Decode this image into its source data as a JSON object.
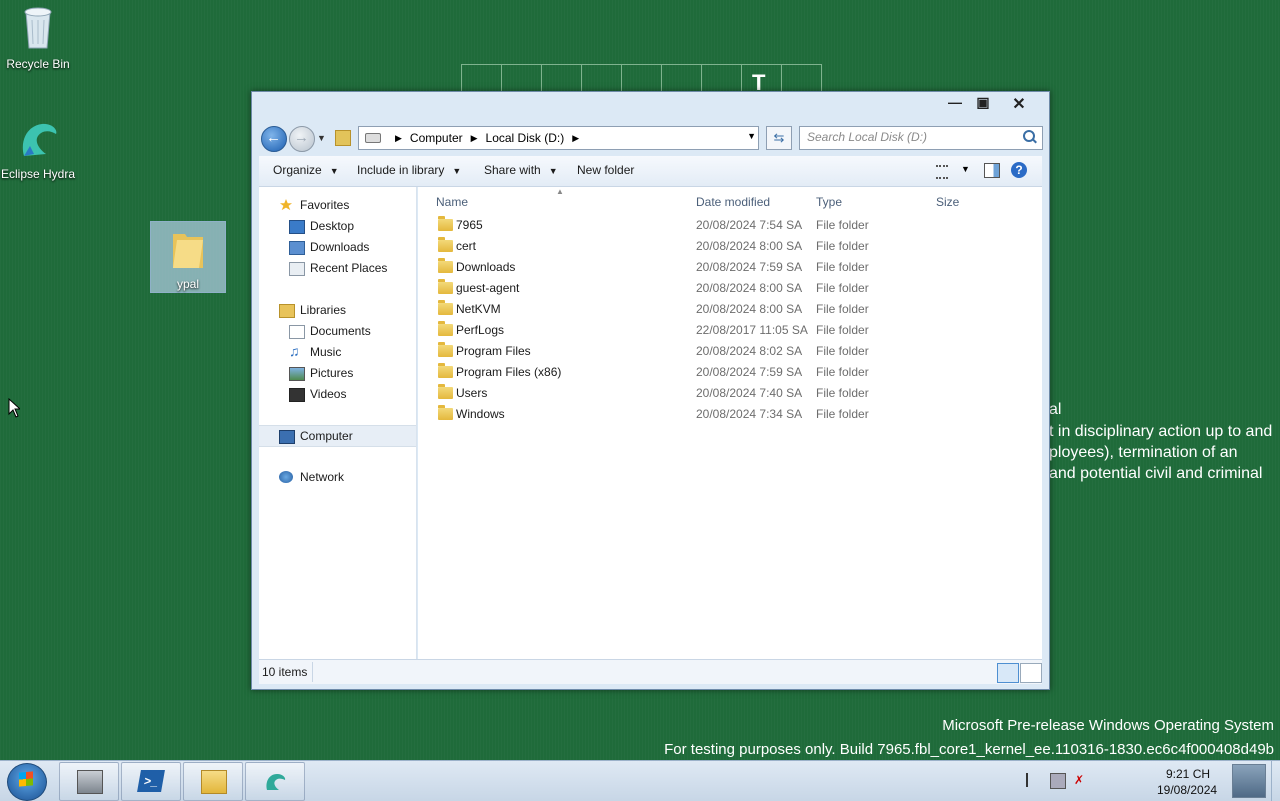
{
  "desktop": {
    "icons": [
      {
        "label": "Recycle Bin"
      },
      {
        "label": "Eclipse Hydra"
      },
      {
        "label": "ypal"
      }
    ],
    "bg_letter": "T",
    "notice_lines": [
      "al",
      "t in disciplinary action up to and",
      "ployees), termination of an",
      "and potential civil and criminal"
    ],
    "build_lines": [
      "Microsoft Pre-release Windows Operating System",
      "For testing purposes only. Build 7965.fbl_core1_kernel_ee.110316-1830.ec6c4f000408d49b"
    ]
  },
  "window": {
    "address": {
      "crumbs": [
        "Computer",
        "Local Disk (D:)"
      ]
    },
    "search_placeholder": "Search Local Disk (D:)",
    "toolbar": {
      "organize": "Organize",
      "include": "Include in library",
      "share": "Share with",
      "new_folder": "New folder"
    },
    "nav": {
      "favorites": "Favorites",
      "favorites_items": [
        "Desktop",
        "Downloads",
        "Recent Places"
      ],
      "libraries": "Libraries",
      "libraries_items": [
        "Documents",
        "Music",
        "Pictures",
        "Videos"
      ],
      "computer": "Computer",
      "network": "Network"
    },
    "columns": {
      "name": "Name",
      "date": "Date modified",
      "type": "Type",
      "size": "Size"
    },
    "files": [
      {
        "name": "7965",
        "date": "20/08/2024 7:54 SA",
        "type": "File folder"
      },
      {
        "name": "cert",
        "date": "20/08/2024 8:00 SA",
        "type": "File folder"
      },
      {
        "name": "Downloads",
        "date": "20/08/2024 7:59 SA",
        "type": "File folder"
      },
      {
        "name": "guest-agent",
        "date": "20/08/2024 8:00 SA",
        "type": "File folder"
      },
      {
        "name": "NetKVM",
        "date": "20/08/2024 8:00 SA",
        "type": "File folder"
      },
      {
        "name": "PerfLogs",
        "date": "22/08/2017 11:05 SA",
        "type": "File folder"
      },
      {
        "name": "Program Files",
        "date": "20/08/2024 8:02 SA",
        "type": "File folder"
      },
      {
        "name": "Program Files (x86)",
        "date": "20/08/2024 7:59 SA",
        "type": "File folder"
      },
      {
        "name": "Users",
        "date": "20/08/2024 7:40 SA",
        "type": "File folder"
      },
      {
        "name": "Windows",
        "date": "20/08/2024 7:34 SA",
        "type": "File folder"
      }
    ],
    "status": {
      "count": "10 items"
    }
  },
  "taskbar": {
    "apps": [
      "server-manager-icon",
      "powershell-icon",
      "file-explorer-icon",
      "eclipse-hydra-icon"
    ],
    "clock": {
      "time": "9:21 CH",
      "date": "19/08/2024"
    }
  },
  "colors": {
    "desktop_bg": "#1f6b3a",
    "window_frame": "#dce9f5",
    "accent": "#1c5fb1"
  }
}
